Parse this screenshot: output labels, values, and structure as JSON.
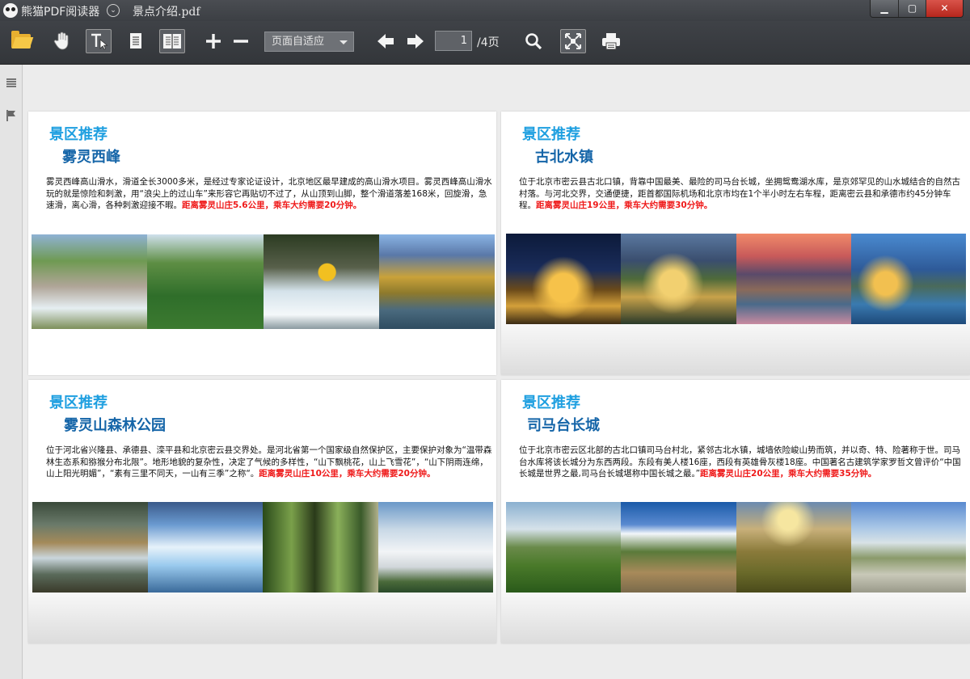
{
  "window": {
    "app_name": "熊猫PDF阅读器",
    "doc_name": "景点介绍.pdf",
    "min_label": "▁",
    "max_label": "▢",
    "close_label": "✕",
    "menu_chevron": "⌄"
  },
  "toolbar": {
    "zoom_mode": "页面自适应",
    "page_current": "1",
    "page_total": "/4页",
    "icons": [
      "open-folder-icon",
      "hand-tool-icon",
      "text-select-icon",
      "single-page-icon",
      "two-page-icon",
      "zoom-in-icon",
      "zoom-out-icon",
      "prev-page-icon",
      "next-page-icon",
      "search-icon",
      "fullscreen-icon",
      "print-icon"
    ]
  },
  "sidebar": {
    "icons": [
      "outline-icon",
      "bookmark-flag-icon"
    ]
  },
  "colors": {
    "heading": "#1e9fe0",
    "spot_title": "#1565a8",
    "highlight": "#ef1a1a"
  },
  "cards": [
    {
      "heading": "景区推荐",
      "title": "雾灵西峰",
      "text": "雾灵西峰高山滑水，滑道全长3000多米，是经过专家论证设计，北京地区最早建成的高山滑水项目。雾灵西峰高山滑水玩的就是惊险和刺激，用“浪尖上的过山车”来形容它再贴切不过了，从山顶到山脚，整个滑道落差168米，回旋滑，急速滑，离心滑，各种刺激迎接不暇。",
      "highlight": "距离雾灵山庄5.6公里，乘车大约需要20分钟。"
    },
    {
      "heading": "景区推荐",
      "title": "古北水镇",
      "text": "位于北京市密云县古北口镇，背靠中国最美、最险的司马台长城，坐拥鸳鸯湖水库，是京郊罕见的山水城结合的自然古村落。与河北交界，交通便捷，距首都国际机场和北京市均在1个半小时左右车程，距离密云县和承德市约45分钟车程。",
      "highlight": "距离雾灵山庄19公里，乘车大约需要30分钟。"
    },
    {
      "heading": "景区推荐",
      "title": "雾灵山森林公园",
      "text": "位于河北省兴隆县、承德县、滦平县和北京密云县交界处。是河北省第一个国家级自然保护区，主要保护对象为“温带森林生态系和猕猴分布北限”。地形地貌的复杂性，决定了气候的多样性，“山下飘桃花，山上飞雪花”，“山下阴雨连绵，山上阳光明媚”，“素有三里不同天，一山有三季”之称“。",
      "highlight": "距离雾灵山庄10公里，乘车大约需要20分钟。"
    },
    {
      "heading": "景区推荐",
      "title": "司马台长城",
      "text": "位于北京市密云区北部的古北口镇司马台村北，紧邻古北水镇，城墙依险峻山势而筑，并以奇、特、险著称于世。司马台水库将该长城分为东西两段。东段有美人楼16座，西段有英雄骨灰楼18座。中国著名古建筑学家罗哲文曾评价“中国长城是世界之最,司马台长城堪称中国长城之最。”",
      "highlight": "距离雾灵山庄20公里，乘车大约需要35分钟。"
    }
  ]
}
